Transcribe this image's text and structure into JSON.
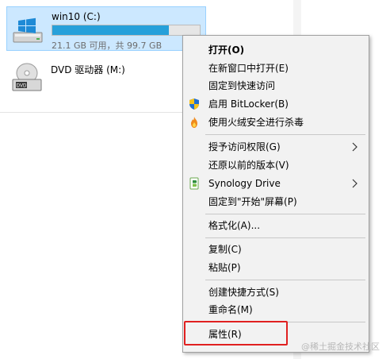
{
  "drives": [
    {
      "name": "win10 (C:)",
      "usage_text": "21.1 GB 可用，共 99.7 GB",
      "used_fraction": 0.79,
      "selected": true
    },
    {
      "name": "DVD 驱动器 (M:)"
    }
  ],
  "dvd_badge": "DVD",
  "watermark": "@稀土掘金技术社区",
  "colors": {
    "selection_bg": "#cce8ff",
    "selection_border": "#99d1ff",
    "usage_bar": "#26a0da",
    "menu_bg": "#f2f2f2",
    "highlight_box": "#e02020"
  },
  "context_menu": {
    "items": [
      {
        "label": "打开(O)",
        "bold": true,
        "icon": null,
        "submenu": false
      },
      {
        "label": "在新窗口中打开(E)",
        "icon": null,
        "submenu": false
      },
      {
        "label": "固定到快速访问",
        "icon": null,
        "submenu": false
      },
      {
        "label": "启用 BitLocker(B)",
        "icon": "shield-icon",
        "submenu": false
      },
      {
        "label": "使用火绒安全进行杀毒",
        "icon": "huorong-flame-icon",
        "submenu": false
      },
      {
        "label": "授予访问权限(G)",
        "icon": null,
        "submenu": true
      },
      {
        "label": "还原以前的版本(V)",
        "icon": null,
        "submenu": false
      },
      {
        "label": "Synology Drive",
        "icon": "synology-drive-icon",
        "submenu": true
      },
      {
        "label": "固定到\"开始\"屏幕(P)",
        "icon": null,
        "submenu": false
      },
      {
        "label": "格式化(A)...",
        "icon": null,
        "submenu": false
      },
      {
        "label": "复制(C)",
        "icon": null,
        "submenu": false
      },
      {
        "label": "粘贴(P)",
        "icon": null,
        "submenu": false
      },
      {
        "label": "创建快捷方式(S)",
        "icon": null,
        "submenu": false
      },
      {
        "label": "重命名(M)",
        "icon": null,
        "submenu": false
      },
      {
        "label": "属性(R)",
        "icon": null,
        "submenu": false,
        "highlighted": true
      }
    ]
  }
}
